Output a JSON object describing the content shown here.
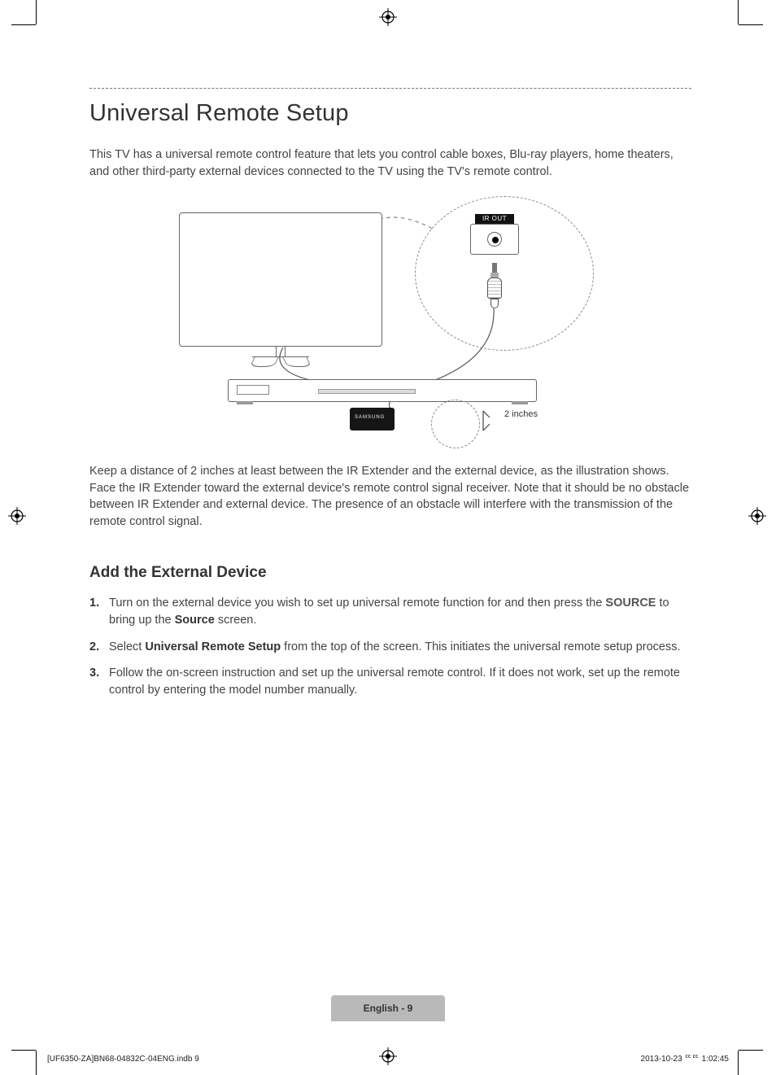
{
  "title": "Universal Remote Setup",
  "intro": "This TV has a universal remote control feature that lets you control cable boxes, Blu-ray players, home theaters, and other third-party external devices connected to the TV using the TV's remote control.",
  "illustration": {
    "port_label": "IR OUT",
    "distance_label": "2 inches",
    "ir_ext_brand": "SAMSUNG"
  },
  "caption": "Keep a distance of 2 inches at least between the IR Extender and the external device, as the illustration shows. Face the IR Extender toward the external device's remote control signal receiver. Note that it should be no obstacle between IR Extender and external device. The presence of an obstacle will interfere with the transmission of the remote control signal.",
  "subheading": "Add the External Device",
  "steps": [
    {
      "num": "1.",
      "pre": "Turn on the external device you wish to set up universal remote function for and then press the ",
      "kw1": "SOURCE",
      "mid": " to bring up the ",
      "kw2": "Source",
      "post": " screen."
    },
    {
      "num": "2.",
      "pre": "Select ",
      "kw1": "Universal Remote Setup",
      "post": " from the top of the screen. This initiates the universal remote setup process."
    },
    {
      "num": "3.",
      "text": "Follow the on-screen instruction and set up the universal remote control. If it does not work, set up the remote control by entering the model number manually."
    }
  ],
  "footer_tab": "English - 9",
  "imprint_left": "[UF6350-ZA]BN68-04832C-04ENG.indb   9",
  "imprint_right": "2013-10-23   ᄄᄄ 1:02:45"
}
